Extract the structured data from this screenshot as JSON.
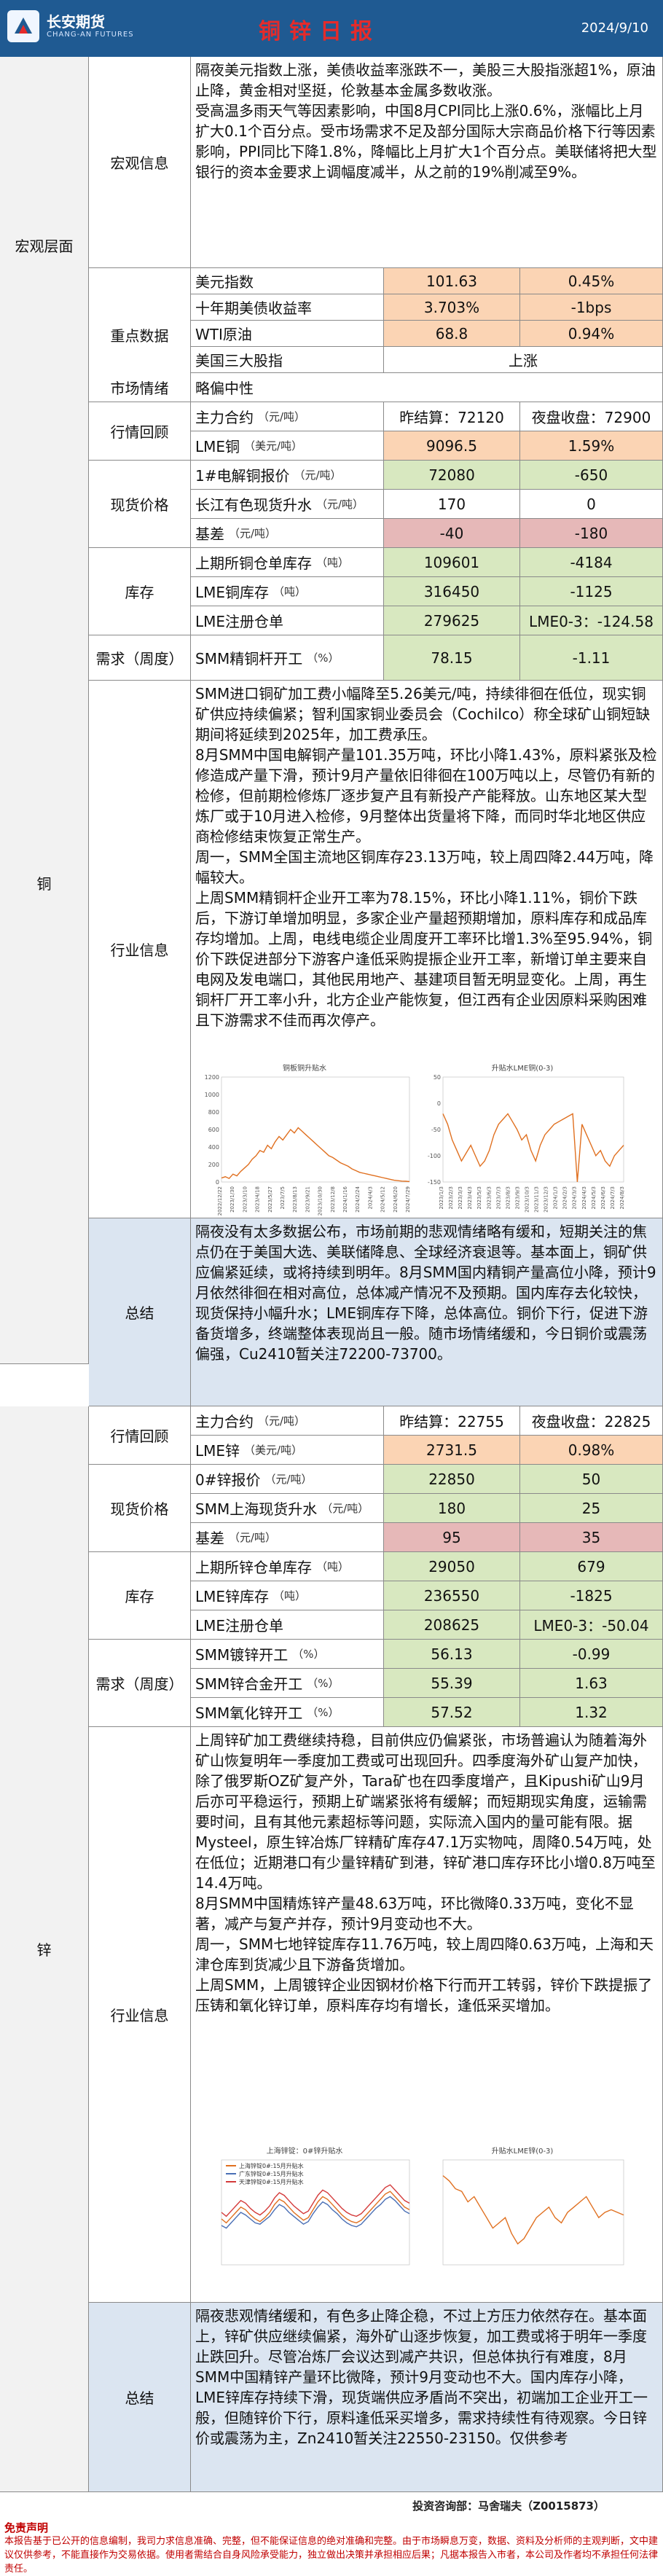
{
  "header": {
    "logo_cn": "长安期货",
    "logo_en": "CHANG-AN FUTURES",
    "title": "铜锌日报",
    "date": "2024/9/10"
  },
  "macro": {
    "section": "宏观层面",
    "info_label": "宏观信息",
    "info_paragraphs": [
      "隔夜美元指数上涨，美债收益率涨跌不一，美股三大股指涨超1%，原油止降，黄金相对坚挺，伦敦基本金属多数收涨。",
      "受高温多雨天气等因素影响，中国8月CPI同比上涨0.6%，涨幅比上月扩大0.1个百分点。受市场需求不足及部分国际大宗商品价格下行等因素影响，PPI同比下降1.8%，降幅比上月扩大1个百分点。美联储将把大型银行的资本金要求上调幅度减半，从之前的19%削减至9%。"
    ],
    "key_label": "重点数据",
    "key_rows": [
      {
        "name": "美元指数",
        "v1": "101.63",
        "v2": "0.45%"
      },
      {
        "name": "十年期美债收益率",
        "v1": "3.703%",
        "v2": "-1bps"
      },
      {
        "name": "WTI原油",
        "v1": "68.8",
        "v2": "0.94%"
      },
      {
        "name": "美国三大股指",
        "v1": "上涨",
        "v2": ""
      }
    ],
    "mood_label": "市场情绪",
    "mood_value": "略偏中性"
  },
  "copper": {
    "section": "铜",
    "quote_label": "行情回顾",
    "main_contract": {
      "name": "主力合约",
      "unit": "（元/吨）",
      "v1": "昨结算：72120",
      "v2": "夜盘收盘：72900"
    },
    "lme": {
      "name": "LME铜",
      "unit": "（美元/吨）",
      "v1": "9096.5",
      "v2": "1.59%"
    },
    "spot_label": "现货价格",
    "spot_rows": [
      {
        "name": "1#电解铜报价",
        "unit": "（元/吨）",
        "v1": "72080",
        "v2": "-650"
      },
      {
        "name": "长江有色现货升水",
        "unit": "（元/吨）",
        "v1": "170",
        "v2": "0"
      },
      {
        "name": "基差",
        "unit": "（元/吨）",
        "v1": "-40",
        "v2": "-180"
      }
    ],
    "stock_label": "库存",
    "stock_rows": [
      {
        "name": "上期所铜仓单库存",
        "unit": "（吨）",
        "v1": "109601",
        "v2": "-4184"
      },
      {
        "name": "LME铜库存",
        "unit": "（吨）",
        "v1": "316450",
        "v2": "-1125"
      },
      {
        "name": "LME注册仓单",
        "unit": "",
        "v1": "279625",
        "v2": "LME0-3：-124.58"
      }
    ],
    "demand_label": "需求（周度）",
    "demand_row": {
      "name": "SMM精铜杆开工",
      "unit": "（%）",
      "v1": "78.15",
      "v2": "-1.11"
    },
    "industry_label": "行业信息",
    "industry_paragraphs": [
      "SMM进口铜矿加工费小幅降至5.26美元/吨，持续徘徊在低位，现实铜矿供应持续偏紧；智利国家铜业委员会（Cochilco）称全球矿山铜短缺期间将延续到2025年，加工费承压。",
      "8月SMM中国电解铜产量101.35万吨，环比小降1.43%，原料紧张及检修造成产量下滑，预计9月产量依旧徘徊在100万吨以上，尽管仍有新的检修，但前期检修炼厂逐步复产且有新投产产能释放。山东地区某大型炼厂或于10月进入检修，9月整体出货量将下降，而同时华北地区供应商检修结束恢复正常生产。",
      "周一，SMM全国主流地区铜库存23.13万吨，较上周四降2.44万吨，降幅较大。",
      "上周SMM精铜杆企业开工率为78.15%，环比小降1.11%，铜价下跌后，下游订单增加明显，多家企业产量超预期增加，原料库存和成品库存均增加。上周，电线电缆企业周度开工率环比增1.3%至95.94%，铜价下跌促进部分下游客户逢低采购提振企业开工率，新增订单主要来自电网及发电端口，其他民用地产、基建项目暂无明显变化。上周，再生铜杆厂开工率小升，北方企业产能恢复，但江西有企业因原料采购困难且下游需求不佳而再次停产。"
    ],
    "chart1": {
      "type": "line",
      "title": "铜板铜升贴水",
      "series": [
        {
          "name": "铜板铜升贴水",
          "values": [
            45,
            60,
            40,
            90,
            70,
            120,
            160,
            200,
            260,
            300,
            360,
            340,
            420,
            380,
            460,
            520,
            480,
            540,
            600,
            560,
            620,
            580,
            540,
            500,
            460,
            420,
            380,
            340,
            300,
            280,
            250,
            220,
            200,
            180,
            150,
            130,
            110,
            100,
            90,
            80,
            70,
            60,
            50,
            40,
            30,
            20,
            15,
            10,
            8,
            5
          ]
        }
      ],
      "ylim": [
        0,
        1200
      ],
      "x": [
        "2022/12/22",
        "2023/1/30",
        "2023/3/10",
        "2023/4/18",
        "2023/5/27",
        "2023/7/5",
        "2023/8/13",
        "2023/9/21",
        "2023/10/30",
        "2023/12/8",
        "2024/1/16",
        "2024/2/24",
        "2024/4/3",
        "2024/5/12",
        "2024/6/20",
        "2024/7/29"
      ],
      "yticks": [
        "1200",
        "1000",
        "800",
        "600",
        "400",
        "200",
        "0"
      ]
    },
    "chart2": {
      "type": "line",
      "title": "升贴水LME铜(0-3)",
      "series": [
        {
          "name": "升贴水LME铜(0-3)",
          "values": [
            -20,
            -40,
            -70,
            -90,
            -110,
            -95,
            -80,
            -100,
            -120,
            -110,
            -90,
            -60,
            -40,
            -30,
            -20,
            -35,
            -50,
            -70,
            -60,
            -90,
            -110,
            -80,
            -60,
            -50,
            -40,
            -35,
            -30,
            -25,
            -20,
            -150,
            -40,
            -60,
            -80,
            -100,
            -90,
            -110,
            -120,
            -100,
            -90,
            -80
          ]
        }
      ],
      "ylim": [
        -150,
        50
      ],
      "x": [
        "2023/1/3",
        "2023/2/3",
        "2023/3/3",
        "2023/4/3",
        "2023/5/3",
        "2023/6/3",
        "2023/7/3",
        "2023/8/3",
        "2023/9/3",
        "2023/10/3",
        "2023/11/3",
        "2023/12/3",
        "2024/1/3",
        "2024/2/3",
        "2024/3/3",
        "2024/4/3",
        "2024/5/3",
        "2024/6/3",
        "2024/7/3",
        "2024/8/3"
      ],
      "yticks": [
        "50",
        "0",
        "-50",
        "-100",
        "-150"
      ]
    },
    "summary_label": "总结",
    "summary_text": "隔夜没有太多数据公布，市场前期的悲观情绪略有缓和，短期关注的焦点仍在于美国大选、美联储降息、全球经济衰退等。基本面上，铜矿供应偏紧延续，或将持续到明年。8月SMM国内精铜产量高位小降，预计9月依然徘徊在相对高位，总体减产情况不及预期。国内库存去化较快，现货保持小幅升水；LME铜库存下降，总体高位。铜价下行，促进下游备货增多，终端整体表现尚且一般。随市场情绪缓和，今日铜价或震荡偏强，Cu2410暂关注72200-73700。"
  },
  "zinc": {
    "section": "锌",
    "quote_label": "行情回顾",
    "main_contract": {
      "name": "主力合约",
      "unit": "（元/吨）",
      "v1": "昨结算：22755",
      "v2": "夜盘收盘：22825"
    },
    "lme": {
      "name": "LME锌",
      "unit": "（美元/吨）",
      "v1": "2731.5",
      "v2": "0.98%"
    },
    "spot_label": "现货价格",
    "spot_rows": [
      {
        "name": "0#锌报价",
        "unit": "（元/吨）",
        "v1": "22850",
        "v2": "50"
      },
      {
        "name": "SMM上海现货升水",
        "unit": "（元/吨）",
        "v1": "180",
        "v2": "25"
      },
      {
        "name": "基差",
        "unit": "（元/吨）",
        "v1": "95",
        "v2": "35"
      }
    ],
    "stock_label": "库存",
    "stock_rows": [
      {
        "name": "上期所锌仓单库存",
        "unit": "（吨）",
        "v1": "29050",
        "v2": "679"
      },
      {
        "name": "LME锌库存",
        "unit": "（吨）",
        "v1": "236550",
        "v2": "-1825"
      },
      {
        "name": "LME注册仓单",
        "unit": "",
        "v1": "208625",
        "v2": "LME0-3：-50.04"
      }
    ],
    "demand_label": "需求（周度）",
    "demand_rows": [
      {
        "name": "SMM镀锌开工",
        "unit": "（%）",
        "v1": "56.13",
        "v2": "-0.99"
      },
      {
        "name": "SMM锌合金开工",
        "unit": "（%）",
        "v1": "55.39",
        "v2": "1.63"
      },
      {
        "name": "SMM氧化锌开工",
        "unit": "（%）",
        "v1": "57.52",
        "v2": "1.32"
      }
    ],
    "industry_label": "行业信息",
    "industry_paragraphs": [
      "上周锌矿加工费继续持稳，目前供应仍偏紧张，市场普遍认为随着海外矿山恢复明年一季度加工费或可出现回升。四季度海外矿山复产加快，除了俄罗斯OZ矿复产外，Tara矿也在四季度增产，且Kipushi矿山9月后亦可平稳运行，预期上矿端紧张将有缓解；而短期现实角度，运输需要时间，且有其他元素超标等问题，实际流入国内的量可能有限。据Mysteel，原生锌冶炼厂锌精矿库存47.1万实物吨，周降0.54万吨，处在低位；近期港口有少量锌精矿到港，锌矿港口库存环比小增0.8万吨至14.4万吨。",
      "8月SMM中国精炼锌产量48.63万吨，环比微降0.33万吨，变化不显著，减产与复产并存，预计9月变动也不大。",
      "周一，SMM七地锌锭库存11.76万吨，较上周四降0.63万吨，上海和天津仓库到货减少且下游备货增加。",
      "上周SMM，上周镀锌企业因钢材价格下行而开工转弱，锌价下跌提振了压铸和氧化锌订单，原料库存均有增长，逢低采买增加。"
    ],
    "chart1": {
      "type": "line",
      "title": "上海锌锭：0#锌升贴水",
      "legend": [
        "上海锌锭0#:15月升贴水",
        "广东锌锭0#:15月升贴水",
        "天津锌锭0#:15月升贴水"
      ],
      "series": [
        {
          "name": "上海锌锭0#:15月升贴水",
          "values": [
            150,
            120,
            160,
            200,
            240,
            220,
            180,
            150,
            130,
            160,
            200,
            260,
            300,
            280,
            240,
            200,
            170,
            140,
            160,
            220,
            280,
            320,
            300,
            260,
            220,
            180,
            150,
            130,
            120,
            140,
            180,
            220,
            260,
            300,
            340,
            360,
            320,
            280,
            240,
            220
          ]
        },
        {
          "name": "广东锌锭0#:15月升贴水",
          "values": [
            100,
            80,
            120,
            160,
            200,
            180,
            150,
            120,
            110,
            140,
            170,
            220,
            260,
            240,
            200,
            170,
            140,
            110,
            130,
            190,
            240,
            280,
            260,
            220,
            190,
            150,
            120,
            100,
            90,
            110,
            150,
            190,
            230,
            260,
            300,
            320,
            290,
            250,
            210,
            190
          ]
        },
        {
          "name": "天津锌锭0#:15月升贴水",
          "values": [
            200,
            170,
            210,
            250,
            290,
            270,
            230,
            200,
            180,
            210,
            250,
            310,
            350,
            330,
            290,
            250,
            220,
            190,
            210,
            270,
            330,
            370,
            350,
            310,
            270,
            230,
            200,
            180,
            170,
            190,
            230,
            270,
            310,
            350,
            390,
            410,
            370,
            330,
            290,
            270
          ]
        }
      ],
      "ylim": [
        -200,
        600
      ]
    },
    "chart2": {
      "type": "line",
      "title": "升贴水LME锌(0-3)",
      "series": [
        {
          "name": "升贴水LME锌(0-3)",
          "values": [
            20,
            10,
            -5,
            -10,
            -30,
            -20,
            -40,
            -60,
            -80,
            -70,
            -60,
            -90,
            -110,
            -100,
            -80,
            -60,
            -50,
            -40,
            -60,
            -70,
            -50,
            -40,
            -30,
            -20,
            -40,
            -60,
            -50,
            -45,
            -50,
            -55
          ]
        }
      ],
      "ylim": [
        -150,
        50
      ]
    },
    "summary_label": "总结",
    "summary_text": "隔夜悲观情绪缓和，有色多止降企稳，不过上方压力依然存在。基本面上，锌矿供应继续偏紧，海外矿山逐步恢复，加工费或将于明年一季度止跌回升。尽管冶炼厂会议达到减产共识，但总体执行有难度，8月SMM中国精锌产量环比微降，预计9月变动也不大。国内库存小降，LME锌库存持续下滑，现货端供应矛盾尚不突出，初端加工企业开工一般，但随锌价下行，原料逢低采买增多，需求持续性有待观察。今日锌价或震荡为主，Zn2410暂关注22550-23150。仅供参考"
  },
  "footer": {
    "investment": "投资咨询部：马舍瑞夫（Z0015873）",
    "disclaimer_title": "免责声明",
    "disclaimer": "本报告基于已公开的信息编制，我司力求信息准确、完整，但不能保证信息的绝对准确和完整。由于市场瞬息万变，数据、资料及分析师的主观判断，文中建议仅供参考，不能直接作为交易依据。使用者需结合自身风险承受能力，独立做出决策并承担相应后果；凡据本报告入市者，本公司及作者均不承担任何法律责任。"
  }
}
